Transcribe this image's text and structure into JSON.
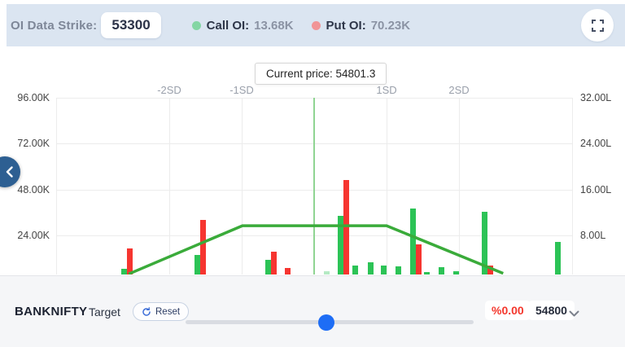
{
  "header": {
    "strike_label": "OI Data Strike:",
    "strike_value": "53300",
    "call_label": "Call OI:",
    "call_value": "13.68K",
    "put_label": "Put OI:",
    "put_value": "70.23K"
  },
  "tooltip": {
    "text": "Current price: 54801.3"
  },
  "footer": {
    "symbol": "BANKNIFTY",
    "target_label": "Target",
    "reset_label": "Reset",
    "change_pct": "%0.00",
    "price_select": "54800"
  },
  "colors": {
    "topbar_bg": "#dbe5f1",
    "call_green": "#2cc356",
    "put_red": "#f63530",
    "payoff_line_green": "#3aab3a",
    "current_price_line": "#8fd492",
    "legend_call_dot": "#84d6a4",
    "legend_put_dot": "#f19597",
    "slider_handle_blue": "#1e6df5",
    "pct_red": "#f4362c",
    "collapse_btn_blue": "#2d5f92"
  },
  "chart_data": {
    "type": "mixed",
    "title": "",
    "grid": true,
    "left_axis": {
      "unit": "K",
      "ticks": [
        "96.00K",
        "72.00K",
        "48.00K",
        "24.00K"
      ],
      "tick_values_k": [
        96,
        72,
        48,
        24
      ],
      "min": 0,
      "max_k": 96
    },
    "right_axis": {
      "unit": "L",
      "ticks": [
        "32.00L",
        "24.00L",
        "16.00L",
        "8.00L"
      ],
      "tick_values_l": [
        32,
        24,
        16,
        8
      ],
      "min": 0,
      "max_l": 32
    },
    "sd_axis_labels": [
      {
        "label": "-2SD",
        "sd": -2
      },
      {
        "label": "-1SD",
        "sd": -1
      },
      {
        "label": "1SD",
        "sd": 1
      },
      {
        "label": "2SD",
        "sd": 2
      }
    ],
    "current_price": {
      "value": 54801.3,
      "sd": 0
    },
    "series_legend": [
      {
        "name": "Call OI",
        "color": "#2cc356"
      },
      {
        "name": "Put OI",
        "color": "#f63530"
      }
    ],
    "bars": [
      {
        "strike_est": 53500,
        "sd": -2.58,
        "call_k": 6.6,
        "put_k": 17.2
      },
      {
        "strike_est": 54000,
        "sd": -1.57,
        "call_k": 13.8,
        "put_k": 32.0
      },
      {
        "strike_est": 54500,
        "sd": -0.59,
        "call_k": 11.3,
        "put_k": 15.5
      },
      {
        "strike_est": 54600,
        "sd": -0.37,
        "call_k": 0,
        "put_k": 7.0
      },
      {
        "strike_est": 54900,
        "sd": 0.17,
        "call_k": 5.3,
        "put_k": 0,
        "pale": true
      },
      {
        "strike_est": 55000,
        "sd": 0.41,
        "call_k": 34.3,
        "put_k": 53.0
      },
      {
        "strike_est": 55100,
        "sd": 0.57,
        "call_k": 8.3,
        "put_k": 0
      },
      {
        "strike_est": 55200,
        "sd": 0.78,
        "call_k": 10.0,
        "put_k": 0
      },
      {
        "strike_est": 55300,
        "sd": 0.96,
        "call_k": 8.3,
        "put_k": 0
      },
      {
        "strike_est": 55400,
        "sd": 1.16,
        "call_k": 7.9,
        "put_k": 0
      },
      {
        "strike_est": 55500,
        "sd": 1.4,
        "call_k": 38.0,
        "put_k": 19.4
      },
      {
        "strike_est": 55600,
        "sd": 1.56,
        "call_k": 4.9,
        "put_k": 0
      },
      {
        "strike_est": 55700,
        "sd": 1.76,
        "call_k": 7.4,
        "put_k": 0
      },
      {
        "strike_est": 55800,
        "sd": 1.96,
        "call_k": 5.4,
        "put_k": 0
      },
      {
        "strike_est": 56000,
        "sd": 2.39,
        "call_k": 36.4,
        "put_k": 8.3
      },
      {
        "strike_est": 56500,
        "sd": 3.36,
        "call_k": 20.5,
        "put_k": 0
      }
    ],
    "line": {
      "name": "range-curve",
      "axis": "right",
      "points_sd_lakh": [
        [
          -2.56,
          1.3
        ],
        [
          -0.99,
          9.7
        ],
        [
          1.0,
          9.7
        ],
        [
          2.61,
          1.4
        ]
      ]
    }
  }
}
